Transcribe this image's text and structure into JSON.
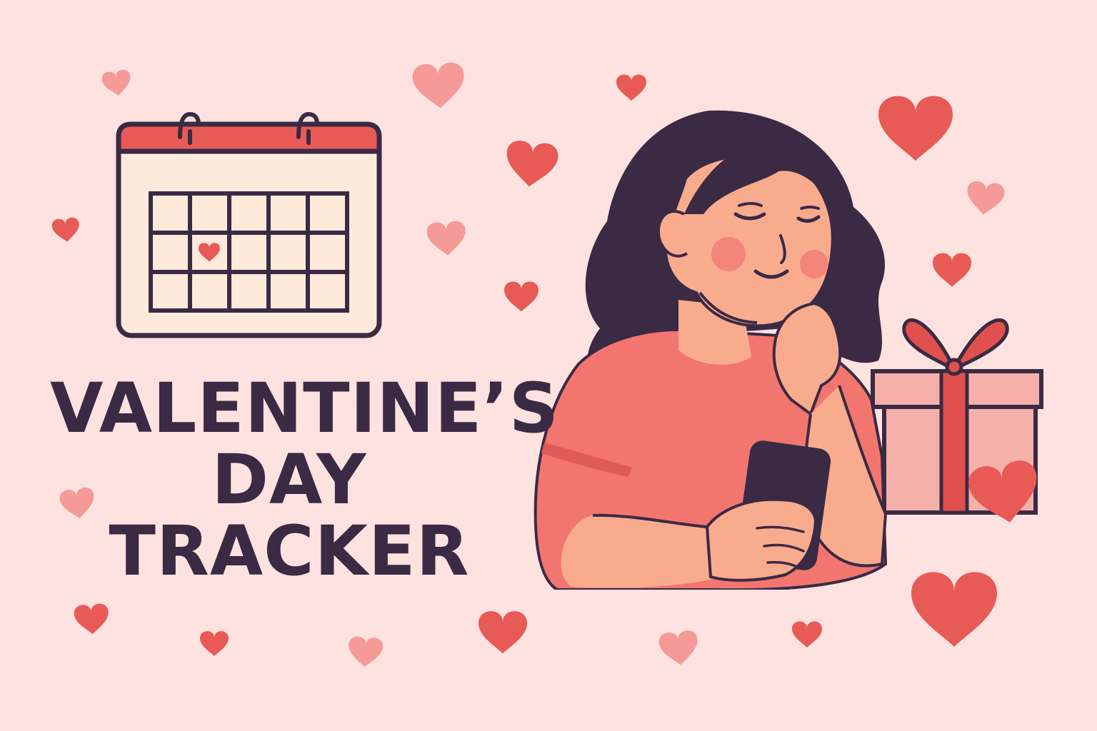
{
  "title": {
    "line1": "VALENTINE’S",
    "line2": "DAY",
    "line3": "TRACKER"
  },
  "colors": {
    "background": "#fde2e0",
    "ink": "#3b2a44",
    "heart_red": "#e85a56",
    "heart_pink": "#f59a96",
    "shirt": "#f2766f",
    "skin": "#f9ab8e",
    "hair": "#3b2a44",
    "calendar_header": "#e85a56",
    "calendar_body": "#fdeadb",
    "gift_box": "#f6b0aa",
    "gift_ribbon": "#e2504d"
  },
  "icons": [
    "calendar-icon",
    "heart-icon",
    "gift-box-icon",
    "smartphone-icon"
  ]
}
